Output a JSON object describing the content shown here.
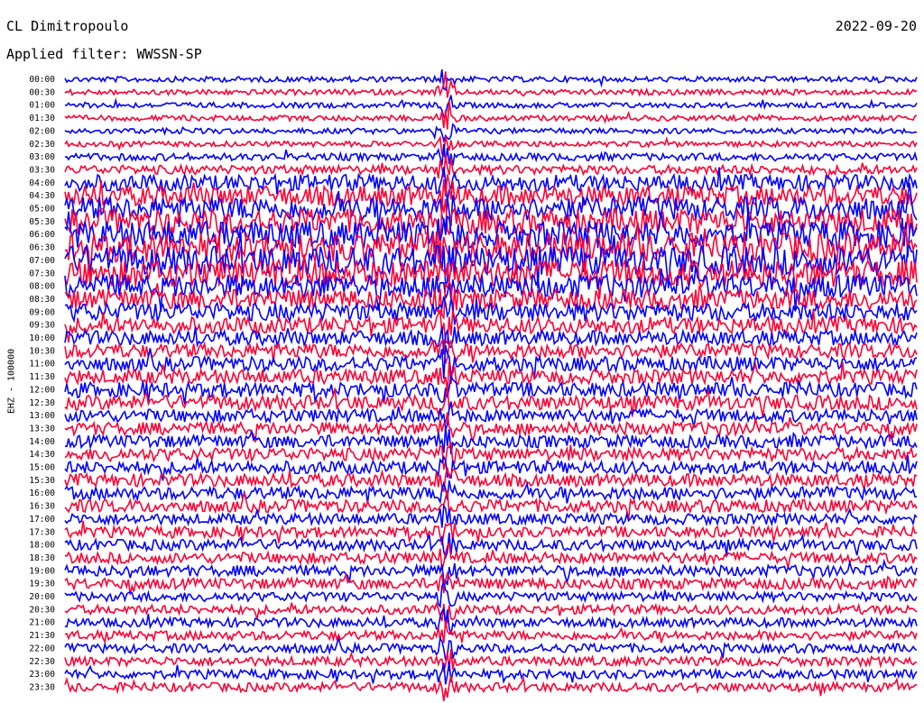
{
  "header": {
    "station": "CL Dimitropoulo",
    "date": "2022-09-20",
    "filter": "Applied filter: WWSSN-SP"
  },
  "chart_data": {
    "type": "line",
    "ylabel": "EHZ - 100000",
    "time_labels": [
      "00:00",
      "00:30",
      "01:00",
      "01:30",
      "02:00",
      "02:30",
      "03:00",
      "03:30",
      "04:00",
      "04:30",
      "05:00",
      "05:30",
      "06:00",
      "06:30",
      "07:00",
      "07:30",
      "08:00",
      "08:30",
      "09:00",
      "09:30",
      "10:00",
      "10:30",
      "11:00",
      "11:30",
      "12:00",
      "12:30",
      "13:00",
      "13:30",
      "14:00",
      "14:30",
      "15:00",
      "15:30",
      "16:00",
      "16:30",
      "17:00",
      "17:30",
      "18:00",
      "18:30",
      "19:00",
      "19:30",
      "20:00",
      "20:30",
      "21:00",
      "21:30",
      "22:00",
      "22:30",
      "23:00",
      "23:30"
    ],
    "noise_level": [
      3,
      3,
      3,
      3,
      3,
      3,
      4,
      5,
      9,
      11,
      13,
      14,
      15,
      16,
      16,
      15,
      13,
      11,
      10,
      9,
      8,
      8,
      8,
      8,
      8,
      8,
      7,
      7,
      7,
      7,
      7,
      7,
      7,
      7,
      6,
      6,
      6,
      6,
      6,
      6,
      5,
      5,
      5,
      5,
      5,
      5,
      5,
      5
    ],
    "colors": {
      "trace_a": "#0000ff",
      "trace_b": "#ff0033"
    }
  }
}
